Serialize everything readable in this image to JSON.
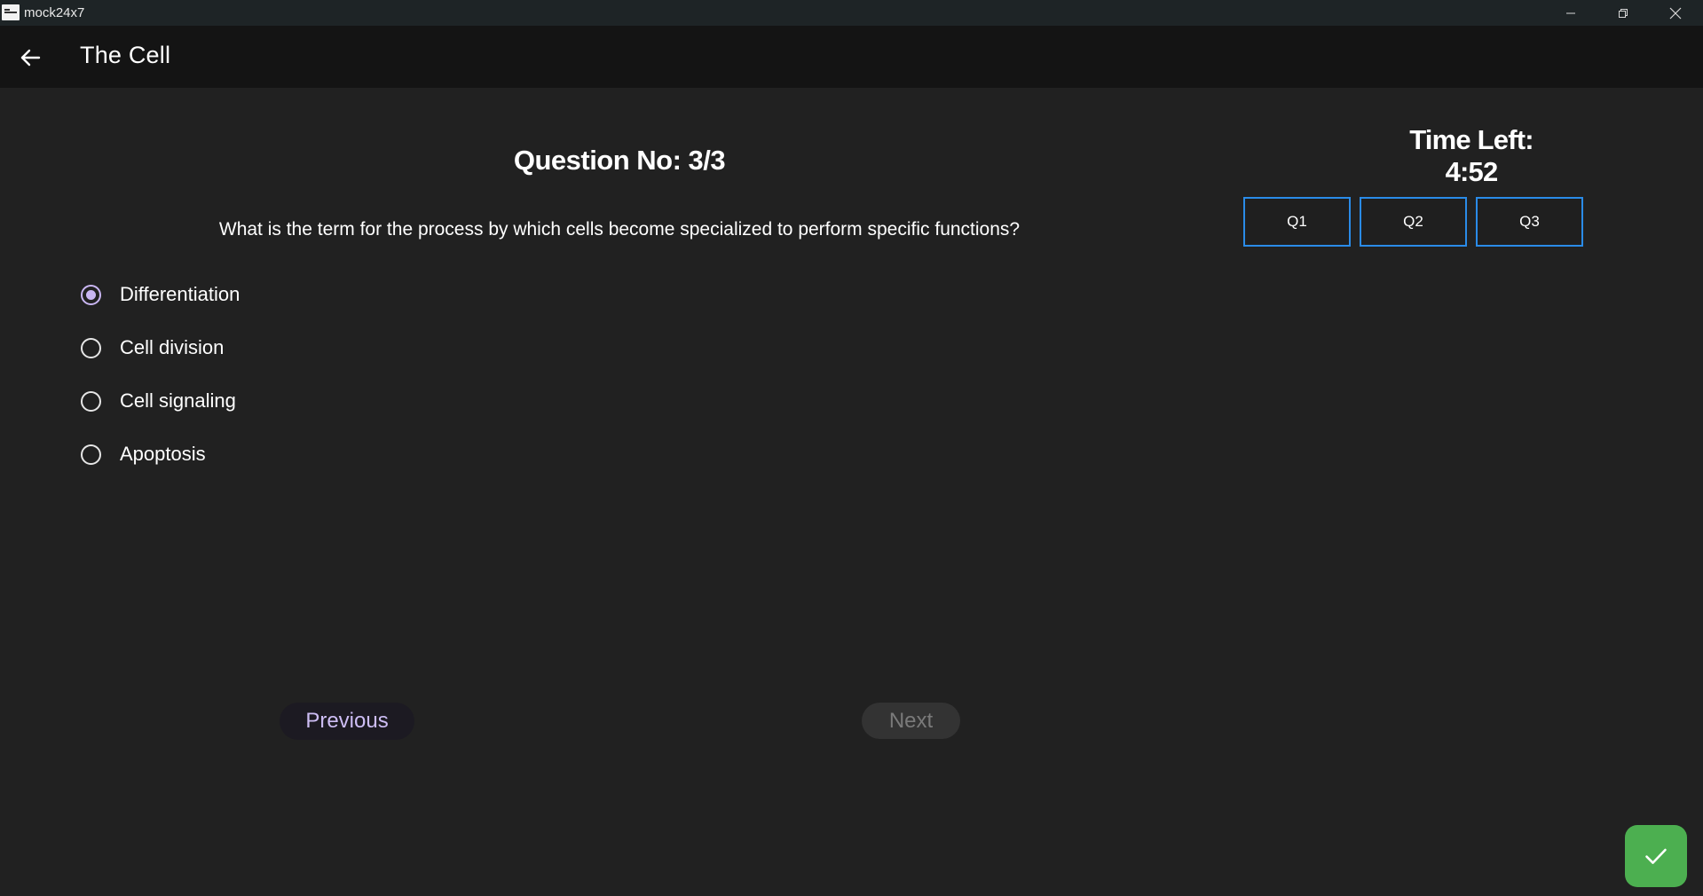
{
  "window": {
    "title": "mock24x7",
    "controls": [
      "minimize-icon",
      "restore-icon",
      "close-icon"
    ]
  },
  "appbar": {
    "back_icon": "arrow-left-icon",
    "title": "The Cell"
  },
  "quiz": {
    "question_number": "Question No: 3/3",
    "question_text": "What is the term for the process by which cells become specialized to perform specific functions?",
    "options": [
      {
        "label": "Differentiation",
        "selected": true
      },
      {
        "label": "Cell division",
        "selected": false
      },
      {
        "label": "Cell signaling",
        "selected": false
      },
      {
        "label": "Apoptosis",
        "selected": false
      }
    ],
    "previous_label": "Previous",
    "next_label": "Next",
    "next_enabled": false
  },
  "sidebar": {
    "timer": "Time Left: 4:52",
    "question_nav": [
      "Q1",
      "Q2",
      "Q3"
    ]
  },
  "submit": {
    "icon": "check-icon"
  },
  "colors": {
    "background": "#212121",
    "appbar": "#141414",
    "accent_purple": "#c9b6f2",
    "nav_border": "#2a8be8",
    "submit_green": "#4caf50"
  }
}
